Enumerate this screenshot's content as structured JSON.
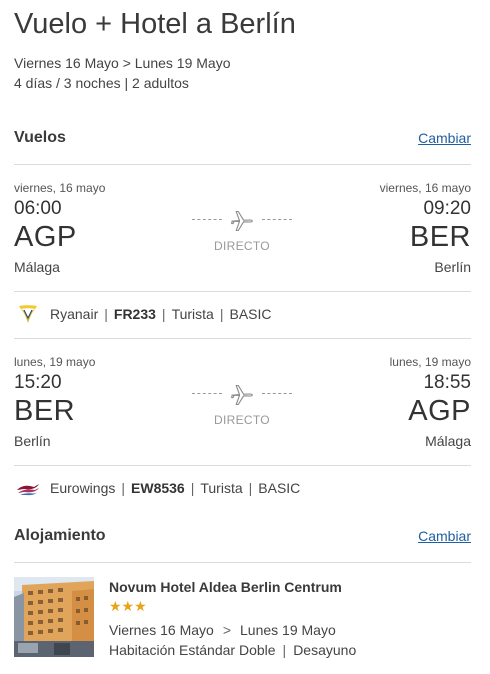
{
  "header": {
    "title": "Vuelo + Hotel a Berlín",
    "dates": "Viernes 16 Mayo > Lunes 19 Mayo",
    "summary": "4 días / 3 noches | 2 adultos"
  },
  "flights": {
    "section_title": "Vuelos",
    "change_label": "Cambiar",
    "direct_label": "DIRECTO",
    "legs": [
      {
        "dep_date": "viernes, 16 mayo",
        "dep_time": "06:00",
        "dep_code": "AGP",
        "dep_city": "Málaga",
        "arr_date": "viernes, 16 mayo",
        "arr_time": "09:20",
        "arr_code": "BER",
        "arr_city": "Berlín",
        "airline": "Ryanair",
        "flight_no": "FR233",
        "cabin": "Turista",
        "fare": "BASIC",
        "airline_logo": "ryanair-harp-logo"
      },
      {
        "dep_date": "lunes, 19 mayo",
        "dep_time": "15:20",
        "dep_code": "BER",
        "dep_city": "Berlín",
        "arr_date": "lunes, 19 mayo",
        "arr_time": "18:55",
        "arr_code": "AGP",
        "arr_city": "Málaga",
        "airline": "Eurowings",
        "flight_no": "EW8536",
        "cabin": "Turista",
        "fare": "BASIC",
        "airline_logo": "eurowings-logo"
      }
    ]
  },
  "accommodation": {
    "section_title": "Alojamiento",
    "change_label": "Cambiar",
    "hotel_name": "Novum Hotel Aldea Berlin Centrum",
    "stars": "★★★",
    "star_count": 3,
    "check_in": "Viernes 16 Mayo",
    "arrow": ">",
    "check_out": "Lunes 19 Mayo",
    "room": "Habitación Estándar Doble",
    "board": "Desayuno"
  },
  "colors": {
    "link": "#1f5fa0",
    "star": "#e8a316",
    "divider": "#dcdcdc"
  }
}
